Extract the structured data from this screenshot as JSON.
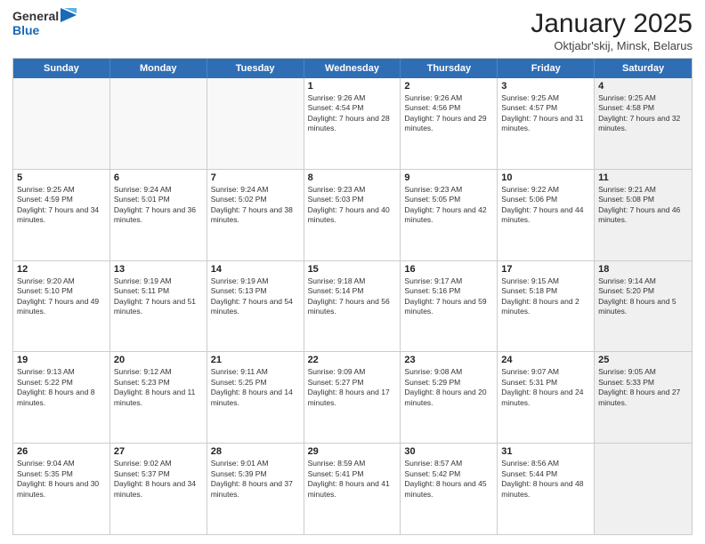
{
  "header": {
    "logo_general": "General",
    "logo_blue": "Blue",
    "title": "January 2025",
    "subtitle": "Oktjabr'skij, Minsk, Belarus"
  },
  "weekdays": [
    "Sunday",
    "Monday",
    "Tuesday",
    "Wednesday",
    "Thursday",
    "Friday",
    "Saturday"
  ],
  "rows": [
    [
      {
        "day": "",
        "sunrise": "",
        "sunset": "",
        "daylight": "",
        "shaded": false,
        "empty": true
      },
      {
        "day": "",
        "sunrise": "",
        "sunset": "",
        "daylight": "",
        "shaded": false,
        "empty": true
      },
      {
        "day": "",
        "sunrise": "",
        "sunset": "",
        "daylight": "",
        "shaded": false,
        "empty": true
      },
      {
        "day": "1",
        "sunrise": "Sunrise: 9:26 AM",
        "sunset": "Sunset: 4:54 PM",
        "daylight": "Daylight: 7 hours and 28 minutes.",
        "shaded": false,
        "empty": false
      },
      {
        "day": "2",
        "sunrise": "Sunrise: 9:26 AM",
        "sunset": "Sunset: 4:56 PM",
        "daylight": "Daylight: 7 hours and 29 minutes.",
        "shaded": false,
        "empty": false
      },
      {
        "day": "3",
        "sunrise": "Sunrise: 9:25 AM",
        "sunset": "Sunset: 4:57 PM",
        "daylight": "Daylight: 7 hours and 31 minutes.",
        "shaded": false,
        "empty": false
      },
      {
        "day": "4",
        "sunrise": "Sunrise: 9:25 AM",
        "sunset": "Sunset: 4:58 PM",
        "daylight": "Daylight: 7 hours and 32 minutes.",
        "shaded": true,
        "empty": false
      }
    ],
    [
      {
        "day": "5",
        "sunrise": "Sunrise: 9:25 AM",
        "sunset": "Sunset: 4:59 PM",
        "daylight": "Daylight: 7 hours and 34 minutes.",
        "shaded": false,
        "empty": false
      },
      {
        "day": "6",
        "sunrise": "Sunrise: 9:24 AM",
        "sunset": "Sunset: 5:01 PM",
        "daylight": "Daylight: 7 hours and 36 minutes.",
        "shaded": false,
        "empty": false
      },
      {
        "day": "7",
        "sunrise": "Sunrise: 9:24 AM",
        "sunset": "Sunset: 5:02 PM",
        "daylight": "Daylight: 7 hours and 38 minutes.",
        "shaded": false,
        "empty": false
      },
      {
        "day": "8",
        "sunrise": "Sunrise: 9:23 AM",
        "sunset": "Sunset: 5:03 PM",
        "daylight": "Daylight: 7 hours and 40 minutes.",
        "shaded": false,
        "empty": false
      },
      {
        "day": "9",
        "sunrise": "Sunrise: 9:23 AM",
        "sunset": "Sunset: 5:05 PM",
        "daylight": "Daylight: 7 hours and 42 minutes.",
        "shaded": false,
        "empty": false
      },
      {
        "day": "10",
        "sunrise": "Sunrise: 9:22 AM",
        "sunset": "Sunset: 5:06 PM",
        "daylight": "Daylight: 7 hours and 44 minutes.",
        "shaded": false,
        "empty": false
      },
      {
        "day": "11",
        "sunrise": "Sunrise: 9:21 AM",
        "sunset": "Sunset: 5:08 PM",
        "daylight": "Daylight: 7 hours and 46 minutes.",
        "shaded": true,
        "empty": false
      }
    ],
    [
      {
        "day": "12",
        "sunrise": "Sunrise: 9:20 AM",
        "sunset": "Sunset: 5:10 PM",
        "daylight": "Daylight: 7 hours and 49 minutes.",
        "shaded": false,
        "empty": false
      },
      {
        "day": "13",
        "sunrise": "Sunrise: 9:19 AM",
        "sunset": "Sunset: 5:11 PM",
        "daylight": "Daylight: 7 hours and 51 minutes.",
        "shaded": false,
        "empty": false
      },
      {
        "day": "14",
        "sunrise": "Sunrise: 9:19 AM",
        "sunset": "Sunset: 5:13 PM",
        "daylight": "Daylight: 7 hours and 54 minutes.",
        "shaded": false,
        "empty": false
      },
      {
        "day": "15",
        "sunrise": "Sunrise: 9:18 AM",
        "sunset": "Sunset: 5:14 PM",
        "daylight": "Daylight: 7 hours and 56 minutes.",
        "shaded": false,
        "empty": false
      },
      {
        "day": "16",
        "sunrise": "Sunrise: 9:17 AM",
        "sunset": "Sunset: 5:16 PM",
        "daylight": "Daylight: 7 hours and 59 minutes.",
        "shaded": false,
        "empty": false
      },
      {
        "day": "17",
        "sunrise": "Sunrise: 9:15 AM",
        "sunset": "Sunset: 5:18 PM",
        "daylight": "Daylight: 8 hours and 2 minutes.",
        "shaded": false,
        "empty": false
      },
      {
        "day": "18",
        "sunrise": "Sunrise: 9:14 AM",
        "sunset": "Sunset: 5:20 PM",
        "daylight": "Daylight: 8 hours and 5 minutes.",
        "shaded": true,
        "empty": false
      }
    ],
    [
      {
        "day": "19",
        "sunrise": "Sunrise: 9:13 AM",
        "sunset": "Sunset: 5:22 PM",
        "daylight": "Daylight: 8 hours and 8 minutes.",
        "shaded": false,
        "empty": false
      },
      {
        "day": "20",
        "sunrise": "Sunrise: 9:12 AM",
        "sunset": "Sunset: 5:23 PM",
        "daylight": "Daylight: 8 hours and 11 minutes.",
        "shaded": false,
        "empty": false
      },
      {
        "day": "21",
        "sunrise": "Sunrise: 9:11 AM",
        "sunset": "Sunset: 5:25 PM",
        "daylight": "Daylight: 8 hours and 14 minutes.",
        "shaded": false,
        "empty": false
      },
      {
        "day": "22",
        "sunrise": "Sunrise: 9:09 AM",
        "sunset": "Sunset: 5:27 PM",
        "daylight": "Daylight: 8 hours and 17 minutes.",
        "shaded": false,
        "empty": false
      },
      {
        "day": "23",
        "sunrise": "Sunrise: 9:08 AM",
        "sunset": "Sunset: 5:29 PM",
        "daylight": "Daylight: 8 hours and 20 minutes.",
        "shaded": false,
        "empty": false
      },
      {
        "day": "24",
        "sunrise": "Sunrise: 9:07 AM",
        "sunset": "Sunset: 5:31 PM",
        "daylight": "Daylight: 8 hours and 24 minutes.",
        "shaded": false,
        "empty": false
      },
      {
        "day": "25",
        "sunrise": "Sunrise: 9:05 AM",
        "sunset": "Sunset: 5:33 PM",
        "daylight": "Daylight: 8 hours and 27 minutes.",
        "shaded": true,
        "empty": false
      }
    ],
    [
      {
        "day": "26",
        "sunrise": "Sunrise: 9:04 AM",
        "sunset": "Sunset: 5:35 PM",
        "daylight": "Daylight: 8 hours and 30 minutes.",
        "shaded": false,
        "empty": false
      },
      {
        "day": "27",
        "sunrise": "Sunrise: 9:02 AM",
        "sunset": "Sunset: 5:37 PM",
        "daylight": "Daylight: 8 hours and 34 minutes.",
        "shaded": false,
        "empty": false
      },
      {
        "day": "28",
        "sunrise": "Sunrise: 9:01 AM",
        "sunset": "Sunset: 5:39 PM",
        "daylight": "Daylight: 8 hours and 37 minutes.",
        "shaded": false,
        "empty": false
      },
      {
        "day": "29",
        "sunrise": "Sunrise: 8:59 AM",
        "sunset": "Sunset: 5:41 PM",
        "daylight": "Daylight: 8 hours and 41 minutes.",
        "shaded": false,
        "empty": false
      },
      {
        "day": "30",
        "sunrise": "Sunrise: 8:57 AM",
        "sunset": "Sunset: 5:42 PM",
        "daylight": "Daylight: 8 hours and 45 minutes.",
        "shaded": false,
        "empty": false
      },
      {
        "day": "31",
        "sunrise": "Sunrise: 8:56 AM",
        "sunset": "Sunset: 5:44 PM",
        "daylight": "Daylight: 8 hours and 48 minutes.",
        "shaded": false,
        "empty": false
      },
      {
        "day": "",
        "sunrise": "",
        "sunset": "",
        "daylight": "",
        "shaded": true,
        "empty": true
      }
    ]
  ]
}
